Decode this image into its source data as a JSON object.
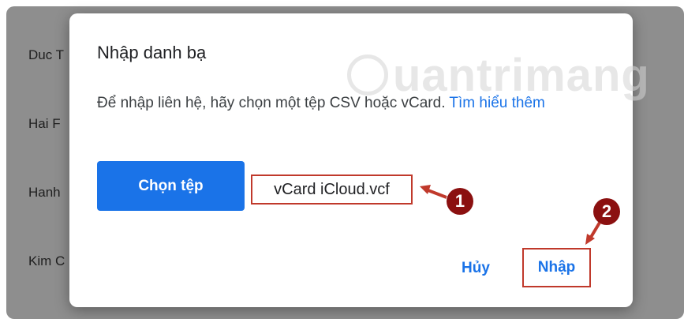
{
  "background": {
    "rows": [
      "Duc T",
      "Hai F",
      "Hanh",
      "Kim C"
    ]
  },
  "dialog": {
    "title": "Nhập danh bạ",
    "description": "Để nhập liên hệ, hãy chọn một tệp CSV hoặc vCard.",
    "learn_more_link": "Tìm hiểu thêm",
    "choose_file_label": "Chọn tệp",
    "selected_file": "vCard iCloud.vcf",
    "cancel_label": "Hủy",
    "import_label": "Nhập"
  },
  "annotations": {
    "badge_1": "1",
    "badge_2": "2"
  },
  "watermark": {
    "text": "uantrimang"
  },
  "colors": {
    "accent": "#1a73e8",
    "highlight": "#c0392b",
    "badge": "#8b1010"
  }
}
